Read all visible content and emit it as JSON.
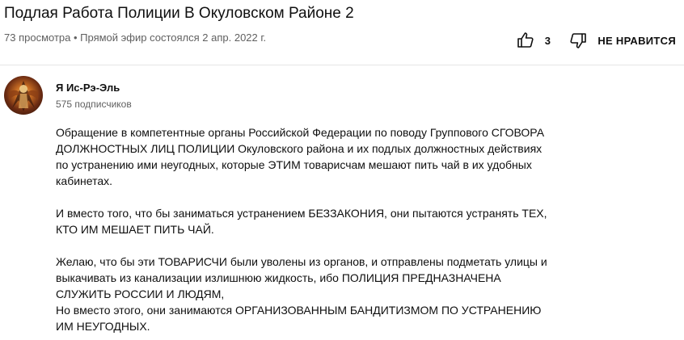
{
  "video": {
    "title": "Подлая Работа Полиции В Окуловском Районе 2",
    "meta": "73 просмотра • Прямой эфир состоялся 2 апр. 2022 г."
  },
  "actions": {
    "like_count": "3",
    "dislike_label": "НЕ НРАВИТСЯ"
  },
  "channel": {
    "name": "Я Ис-Рэ-Эль",
    "subscribers": "575 подписчиков"
  },
  "description": {
    "p1": [
      "Обращение в компетентные органы Российской Федерации по поводу Группового СГОВОРА",
      "ДОЛЖНОСТНЫХ ЛИЦ ПОЛИЦИИ Окуловского района и их подлых должностных действиях",
      "по устранению ими неугодных, которые ЭТИМ товарисчам мешают пить чай в их удобных",
      "кабинетах."
    ],
    "p2": [
      "И вместо того, что бы заниматься устранением БЕЗЗАКОНИЯ, они пытаются устранять ТЕХ,",
      "КТО ИМ МЕШАЕТ ПИТЬ ЧАЙ."
    ],
    "p3": [
      "Желаю, что бы эти ТОВАРИСЧИ были уволены из органов, и отправлены подметать улицы и",
      "выкачивать из канализации излишнюю жидкость, ибо ПОЛИЦИЯ ПРЕДНАЗНАЧЕНА",
      "СЛУЖИТЬ РОССИИ И ЛЮДЯМ,",
      "Но вместо этого, они занимаются ОРГАНИЗОВАННЫМ БАНДИТИЗМОМ ПО УСТРАНЕНИЮ",
      "ИМ НЕУГОДНЫХ."
    ]
  },
  "icons": {
    "like": "thumb-up-icon",
    "dislike": "thumb-down-icon"
  }
}
